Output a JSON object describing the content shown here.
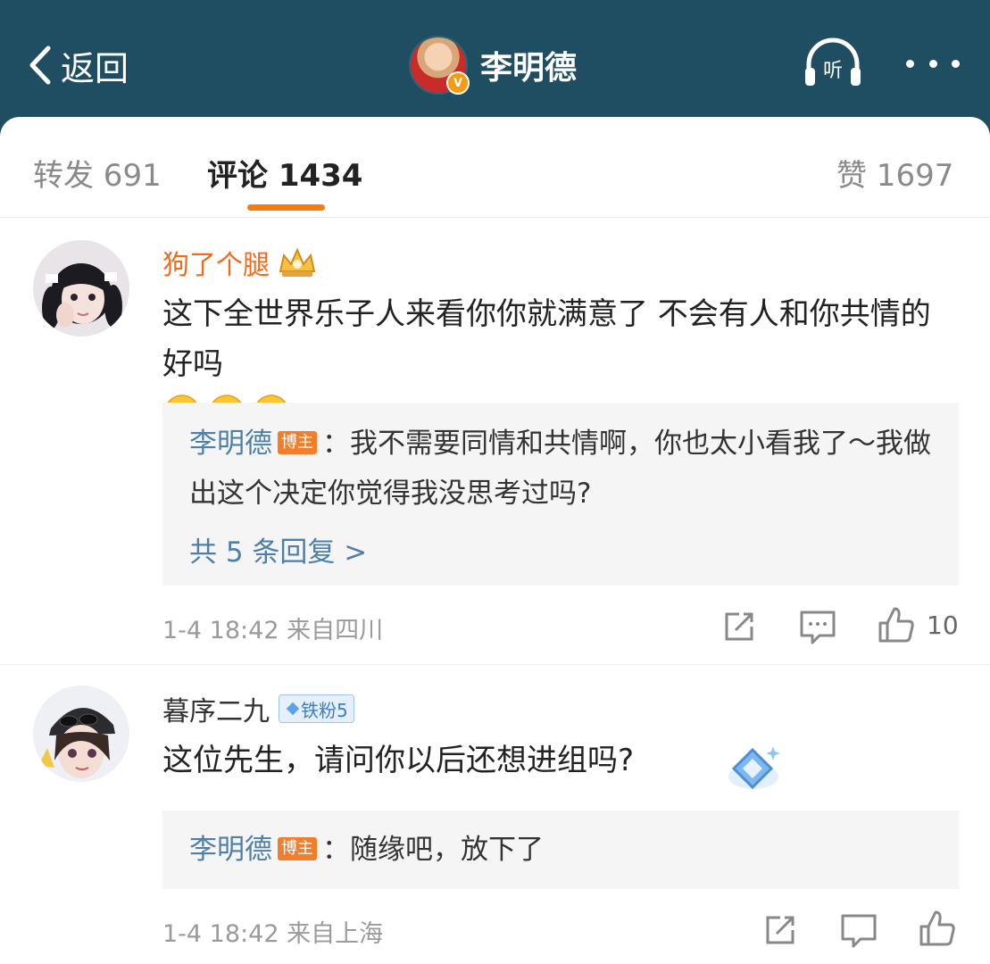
{
  "header": {
    "back_label": "返回",
    "account_name": "李明德",
    "listen_label": "听"
  },
  "tabs": {
    "repost": "转发 691",
    "comments": "评论 1434",
    "likes": "赞 1697"
  },
  "comments": [
    {
      "user": "狗了个腿",
      "text": "这下全世界乐子人来看你你就满意了 不会有人和你共情的好吗",
      "emoji": "laugh-cry",
      "emoji_count": 3,
      "reply": {
        "author": "李明德",
        "badge": "博主",
        "text": "：我不需要同情和共情啊，你也太小看我了～我做出这个决定你觉得我没思考过吗?"
      },
      "more_replies": "共 5 条回复 >",
      "meta": "1-4 18:42  来自四川",
      "like_count": "10"
    },
    {
      "user": "暮序二九",
      "fan_badge": "铁粉5",
      "text": "这位先生，请问你以后还想进组吗?",
      "reply": {
        "author": "李明德",
        "badge": "博主",
        "text": "：随缘吧，放下了"
      },
      "meta": "1-4 18:42  来自上海"
    }
  ],
  "colors": {
    "header_bg": "#1f4e63",
    "accent": "#f77c10",
    "link_blue": "#4e7fa8",
    "vip_name": "#f26b1d"
  }
}
